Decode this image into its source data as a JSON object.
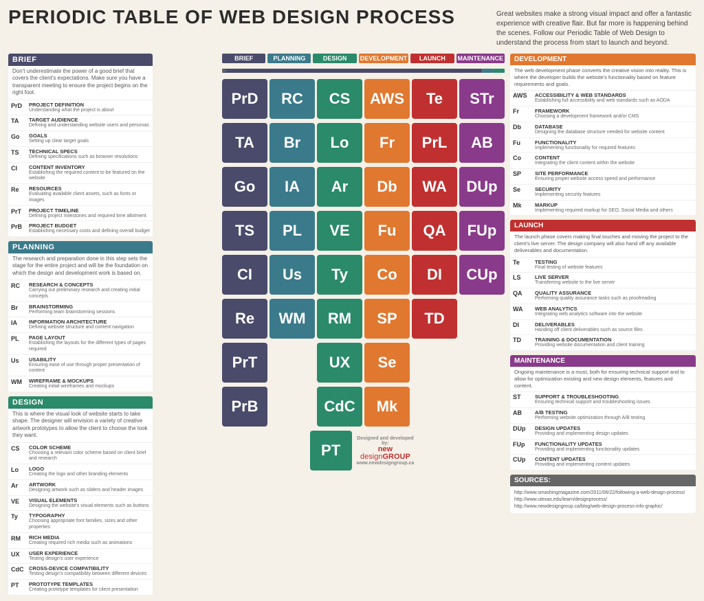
{
  "title": "PERIODIC TABLE OF WEB DESIGN PROCESS",
  "description": "Great websites make a strong visual impact and offer a fantastic experience with creative flair. But far more is happening behind the scenes. Follow our Periodic Table of Web Design to understand the process from start to launch and beyond.",
  "sections": {
    "brief": {
      "label": "BRIEF",
      "description": "Don't underestimate the power of a good brief that covers the client's expectations. Make sure you have a transparent meeting to ensure the project begins on the right foot.",
      "items": [
        {
          "code": "PrD",
          "title": "PROJECT DEFINITION",
          "desc": "Understanding what the project is about"
        },
        {
          "code": "TA",
          "title": "TARGET AUDIENCE",
          "desc": "Defining and understanding website users and personas"
        },
        {
          "code": "Go",
          "title": "GOALS",
          "desc": "Setting up clear target goals"
        },
        {
          "code": "TS",
          "title": "TECHNICAL SPECS",
          "desc": "Defining specifications such as browser resolutions"
        },
        {
          "code": "CI",
          "title": "CONTENT INVENTORY",
          "desc": "Establishing the required content to be featured on the website"
        },
        {
          "code": "Re",
          "title": "RESOURCES",
          "desc": "Evaluating available client assets, such as fonts or images"
        },
        {
          "code": "PrT",
          "title": "PROJECT TIMELINE",
          "desc": "Defining project milestones and required time allotment"
        },
        {
          "code": "PrB",
          "title": "PROJECT BUDGET",
          "desc": "Establishing necessary costs and defining overall budget"
        }
      ]
    },
    "planning": {
      "label": "PLANNING",
      "description": "The research and preparation done in this step sets the stage for the entire project and will be the foundation on which the design and development work is based on.",
      "items": [
        {
          "code": "RC",
          "title": "RESEARCH & CONCEPTS",
          "desc": "Carrying out preliminary research and creating initial concepts"
        },
        {
          "code": "Br",
          "title": "BRAINSTORMING",
          "desc": "Performing team brainstorming sessions"
        },
        {
          "code": "IA",
          "title": "INFORMATION ARCHITECTURE",
          "desc": "Defining website structure and content navigation"
        },
        {
          "code": "PL",
          "title": "PAGE LAYOUT",
          "desc": "Establishing the layouts for the different types of pages required"
        },
        {
          "code": "Us",
          "title": "USABILITY",
          "desc": "Ensuring ease of use through proper presentation of content"
        },
        {
          "code": "WM",
          "title": "WIREFRAME & MOCKUPS",
          "desc": "Creating initial wireframes and mockups"
        }
      ]
    },
    "design": {
      "label": "DESIGN",
      "description": "This is where the visual look of website starts to take shape. The designer will envision a variety of creative artwork prototypes to allow the client to choose the look they want.",
      "items": [
        {
          "code": "CS",
          "title": "COLOR SCHEME",
          "desc": "Choosing a relevant color scheme based on client brief and research"
        },
        {
          "code": "Lo",
          "title": "LOGO",
          "desc": "Creating the logo and other branding elements"
        },
        {
          "code": "Ar",
          "title": "ARTWORK",
          "desc": "Designing artwork such as sliders and header images"
        },
        {
          "code": "VE",
          "title": "VISUAL ELEMENTS",
          "desc": "Designing the website's visual elements such as buttons"
        },
        {
          "code": "Ty",
          "title": "TYPOGRAPHY",
          "desc": "Choosing appropriate font families, sizes and other properties"
        },
        {
          "code": "RM",
          "title": "RICH MEDIA",
          "desc": "Creating required rich media such as animations"
        },
        {
          "code": "UX",
          "title": "USER EXPERIENCE",
          "desc": "Testing design's user experience"
        },
        {
          "code": "CdC",
          "title": "CROSS-DEVICE COMPATIBILITY",
          "desc": "Testing design's compatibility between different devices"
        },
        {
          "code": "PT",
          "title": "PROTOTYPE TEMPLATES",
          "desc": "Creating prototype templates for client presentation"
        }
      ]
    }
  },
  "col_headers": [
    "BRIEF",
    "PLANNING",
    "DESIGN",
    "DEVELOPMENT",
    "LAUNCH",
    "MAINTENANCE"
  ],
  "table_rows": [
    [
      {
        "text": "PrD",
        "type": "brief"
      },
      {
        "text": "RC",
        "type": "planning"
      },
      {
        "text": "CS",
        "type": "design"
      },
      {
        "text": "AWS",
        "type": "development"
      },
      {
        "text": "Te",
        "type": "launch"
      },
      {
        "text": "STr",
        "type": "maintenance"
      }
    ],
    [
      {
        "text": "TA",
        "type": "brief"
      },
      {
        "text": "Br",
        "type": "planning"
      },
      {
        "text": "Lo",
        "type": "design"
      },
      {
        "text": "Fr",
        "type": "development"
      },
      {
        "text": "PrL",
        "type": "launch"
      },
      {
        "text": "AB",
        "type": "maintenance"
      }
    ],
    [
      {
        "text": "Go",
        "type": "brief"
      },
      {
        "text": "IA",
        "type": "planning"
      },
      {
        "text": "Ar",
        "type": "design"
      },
      {
        "text": "Db",
        "type": "development"
      },
      {
        "text": "WA",
        "type": "launch"
      },
      {
        "text": "DUp",
        "type": "maintenance"
      }
    ],
    [
      {
        "text": "TS",
        "type": "brief"
      },
      {
        "text": "PL",
        "type": "planning"
      },
      {
        "text": "VE",
        "type": "design"
      },
      {
        "text": "Fu",
        "type": "development"
      },
      {
        "text": "QA",
        "type": "launch"
      },
      {
        "text": "FUp",
        "type": "maintenance"
      }
    ],
    [
      {
        "text": "CI",
        "type": "brief"
      },
      {
        "text": "Us",
        "type": "planning"
      },
      {
        "text": "Ty",
        "type": "design"
      },
      {
        "text": "Co",
        "type": "development"
      },
      {
        "text": "DI",
        "type": "launch"
      },
      {
        "text": "CUp",
        "type": "maintenance"
      }
    ],
    [
      {
        "text": "Re",
        "type": "brief"
      },
      {
        "text": "WM",
        "type": "planning"
      },
      {
        "text": "RM",
        "type": "design"
      },
      {
        "text": "SP",
        "type": "development"
      },
      {
        "text": "TD",
        "type": "launch"
      },
      {
        "text": "",
        "type": "empty"
      }
    ],
    [
      {
        "text": "PrT",
        "type": "brief"
      },
      {
        "text": "",
        "type": "empty"
      },
      {
        "text": "UX",
        "type": "design"
      },
      {
        "text": "Se",
        "type": "development"
      },
      {
        "text": "",
        "type": "empty"
      },
      {
        "text": "",
        "type": "empty"
      }
    ],
    [
      {
        "text": "PrB",
        "type": "brief"
      },
      {
        "text": "",
        "type": "empty"
      },
      {
        "text": "CdC",
        "type": "design"
      },
      {
        "text": "Mk",
        "type": "development"
      },
      {
        "text": "",
        "type": "empty"
      },
      {
        "text": "",
        "type": "empty"
      }
    ],
    [
      {
        "text": "",
        "type": "empty"
      },
      {
        "text": "",
        "type": "empty"
      },
      {
        "text": "PT",
        "type": "design"
      },
      {
        "text": "",
        "type": "empty"
      },
      {
        "text": "",
        "type": "empty"
      },
      {
        "text": "",
        "type": "empty"
      }
    ]
  ],
  "development": {
    "label": "DEVELOPMENT",
    "description": "The web development phase converts the creative vision into reality. This is where the developer builds the website's functionality based on feature requirements and goals.",
    "items": [
      {
        "code": "AWS",
        "title": "ACCESSIBILITY & WEB STANDARDS",
        "desc": "Establishing full accessibility and web standards such as AODA"
      },
      {
        "code": "Fr",
        "title": "FRAMEWORK",
        "desc": "Choosing a development framework and/or CMS"
      },
      {
        "code": "Db",
        "title": "DATABASE",
        "desc": "Designing the database structure needed for website content"
      },
      {
        "code": "Fu",
        "title": "FUNCTIONALITY",
        "desc": "Implementing functionality for required features"
      },
      {
        "code": "Co",
        "title": "CONTENT",
        "desc": "Integrating the client content within the website"
      },
      {
        "code": "SP",
        "title": "SITE PERFORMANCE",
        "desc": "Ensuring proper website access speed and performance"
      },
      {
        "code": "Se",
        "title": "SECURITY",
        "desc": "Implementing security features"
      },
      {
        "code": "Mk",
        "title": "MARKUP",
        "desc": "Implementing required markup for SEO, Social Media and others"
      }
    ]
  },
  "launch": {
    "label": "LAUNCH",
    "description": "The launch phase covers making final touches and moving the project to the client's live server. The design company will also hand off any available deliverables and documentation.",
    "items": [
      {
        "code": "Te",
        "title": "TESTING",
        "desc": "Final testing of website features"
      },
      {
        "code": "LS",
        "title": "LIVE SERVER",
        "desc": "Transferring website to the live server"
      },
      {
        "code": "QA",
        "title": "QUALITY ASSURANCE",
        "desc": "Performing quality assurance tasks such as proofreading"
      },
      {
        "code": "WA",
        "title": "WEB ANALYTICS",
        "desc": "Integrating web analytics software into the website"
      },
      {
        "code": "DI",
        "title": "DELIVERABLES",
        "desc": "Handing off client deliverables such as source files"
      },
      {
        "code": "TD",
        "title": "TRAINING & DOCUMENTATION",
        "desc": "Providing website documentation and client training"
      }
    ]
  },
  "maintenance": {
    "label": "MAINTENANCE",
    "description": "Ongoing maintenance is a must, both for ensuring technical support and to allow for optimization existing and new design elements, features and content.",
    "items": [
      {
        "code": "ST",
        "title": "SUPPORT & TROUBLESHOOTING",
        "desc": "Ensuring technical support and troubleshooting issues"
      },
      {
        "code": "AB",
        "title": "A/B TESTING",
        "desc": "Performing website optimization through A/B testing"
      },
      {
        "code": "DUp",
        "title": "DESIGN UPDATES",
        "desc": "Providing and implementing design updates"
      },
      {
        "code": "FUp",
        "title": "FUNCTIONALITY UPDATES",
        "desc": "Providing and implementing functionality updates"
      },
      {
        "code": "CUp",
        "title": "CONTENT UPDATES",
        "desc": "Providing and implementing content updates"
      }
    ]
  },
  "sources": {
    "label": "SOURCES:",
    "links": [
      "http://www.smashingmagazine.com/2011/06/22/following-a-web-design-process/",
      "http://www.utexas.edu/learn/designprocess/",
      "http://www.newdesigngroup.ca/blog/web-design-process-info-graphic/"
    ]
  },
  "footer": {
    "designed_by": "Designed and developed by:",
    "brand": "new design GROUP",
    "url": "www.newdesigngroup.ca"
  }
}
